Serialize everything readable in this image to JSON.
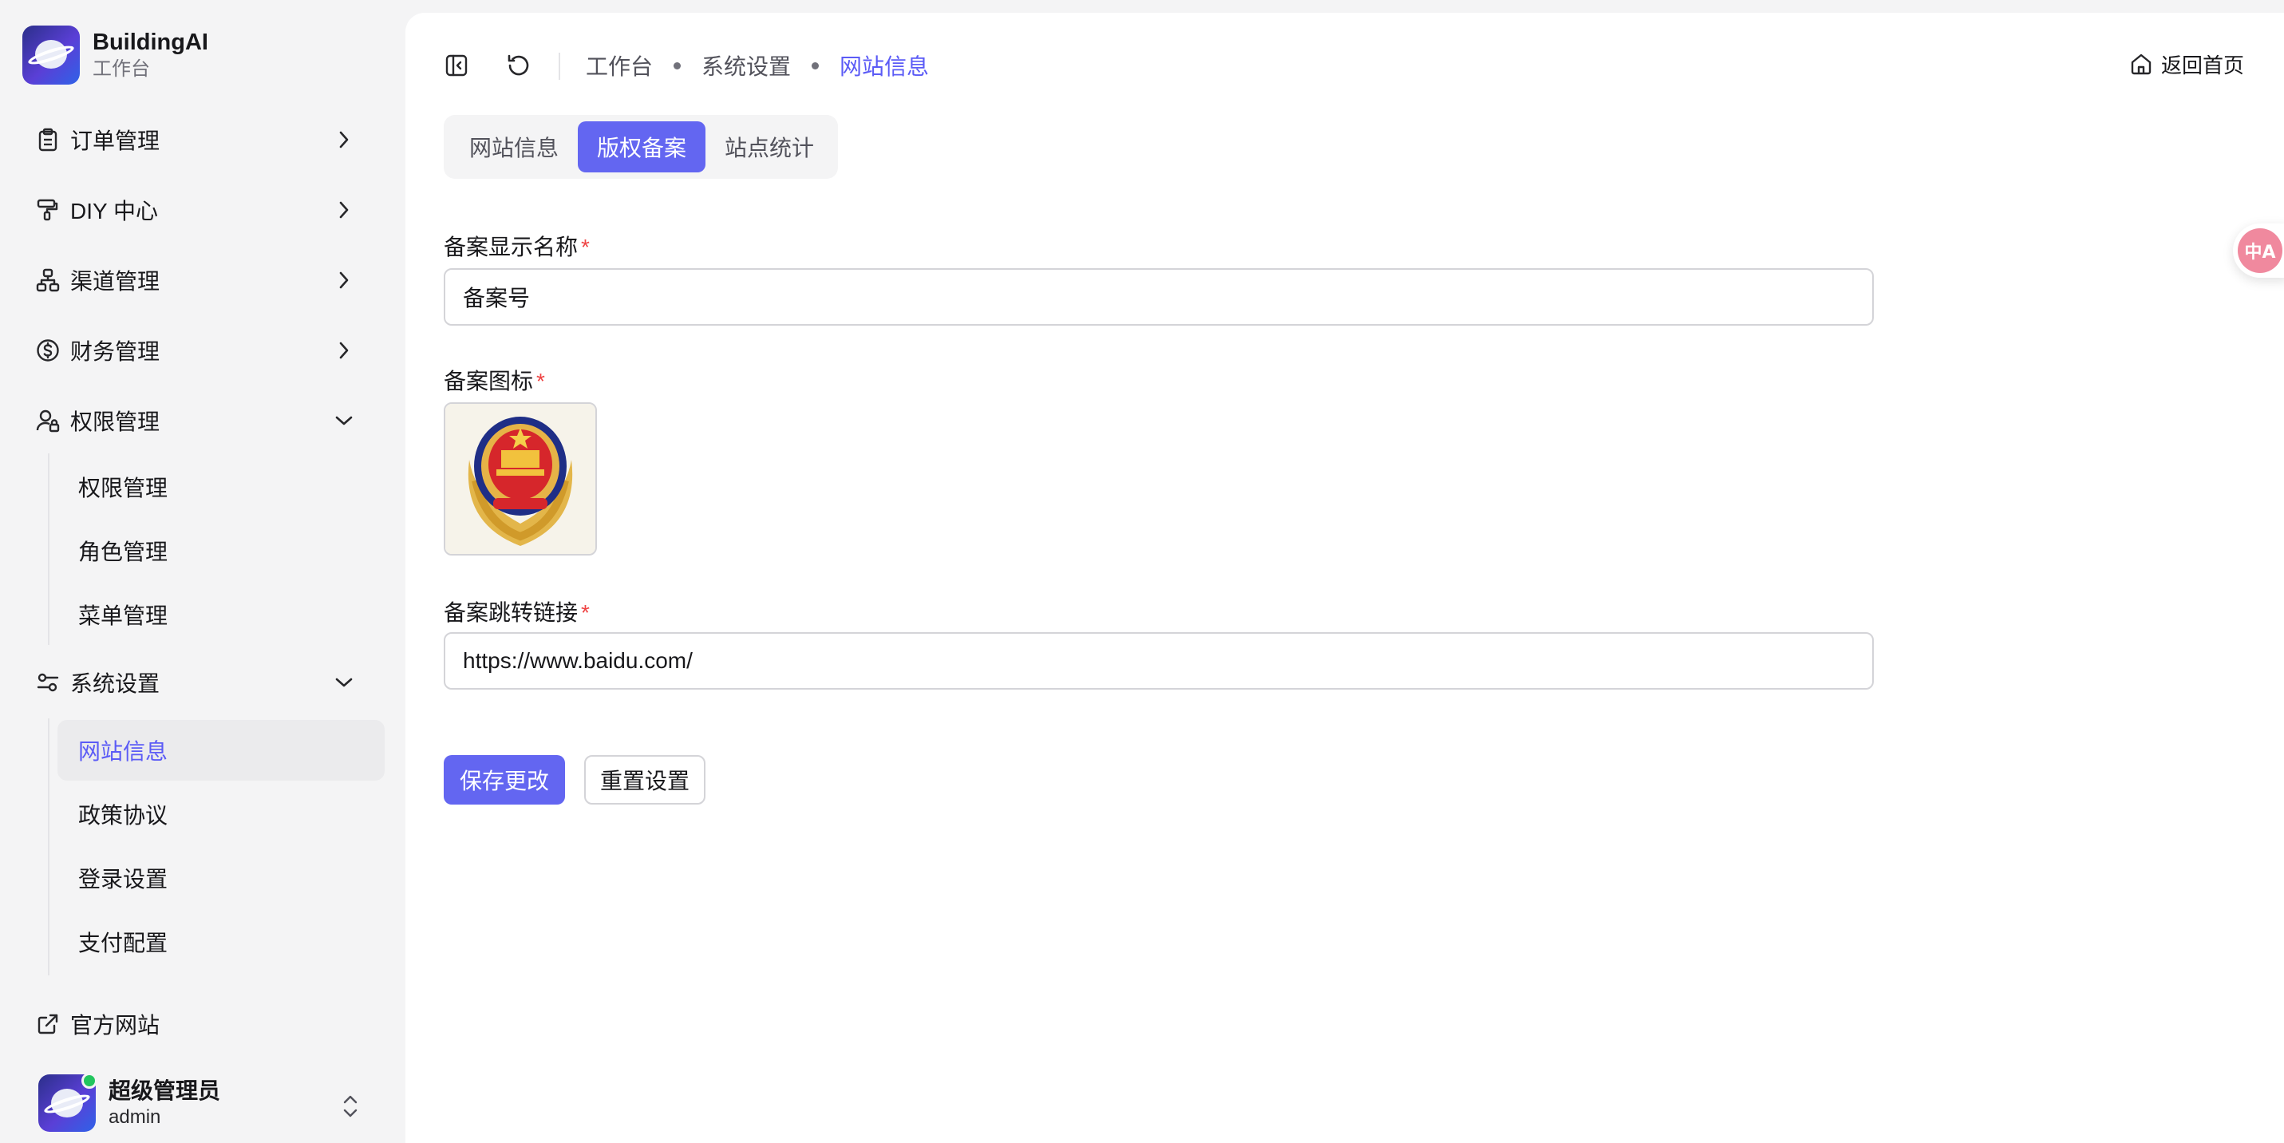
{
  "app": {
    "name": "BuildingAI",
    "subtitle": "工作台"
  },
  "sidebar": {
    "items": [
      {
        "label": "订单管理",
        "icon": "clipboard-icon",
        "expanded": false
      },
      {
        "label": "DIY 中心",
        "icon": "paint-roller-icon",
        "expanded": false
      },
      {
        "label": "渠道管理",
        "icon": "network-icon",
        "expanded": false
      },
      {
        "label": "财务管理",
        "icon": "dollar-circle-icon",
        "expanded": false
      },
      {
        "label": "权限管理",
        "icon": "user-lock-icon",
        "expanded": true,
        "children": [
          "权限管理",
          "角色管理",
          "菜单管理"
        ]
      },
      {
        "label": "系统设置",
        "icon": "settings-sliders-icon",
        "expanded": true,
        "children": [
          "网站信息",
          "政策协议",
          "登录设置",
          "支付配置"
        ],
        "active_child": "网站信息"
      }
    ],
    "external_link": {
      "label": "官方网站",
      "icon": "external-link-icon"
    },
    "user": {
      "name": "超级管理员",
      "role": "admin",
      "status": "online"
    }
  },
  "header": {
    "breadcrumb": [
      "工作台",
      "系统设置",
      "网站信息"
    ],
    "home_link": "返回首页"
  },
  "tabs": {
    "items": [
      "网站信息",
      "版权备案",
      "站点统计"
    ],
    "active": "版权备案"
  },
  "form": {
    "record_name": {
      "label": "备案显示名称",
      "value": "备案号",
      "required": true
    },
    "record_icon": {
      "label": "备案图标",
      "required": true,
      "image": "police-emblem-icon"
    },
    "record_link": {
      "label": "备案跳转链接",
      "value": "https://www.baidu.com/",
      "required": true
    },
    "save_label": "保存更改",
    "reset_label": "重置设置"
  },
  "floating": {
    "translate_icon": "translate-icon",
    "glyph": "中A"
  },
  "colors": {
    "accent": "#6366f1",
    "active_text": "#5b5bf6",
    "required": "#ef4444",
    "online": "#22c55e"
  }
}
